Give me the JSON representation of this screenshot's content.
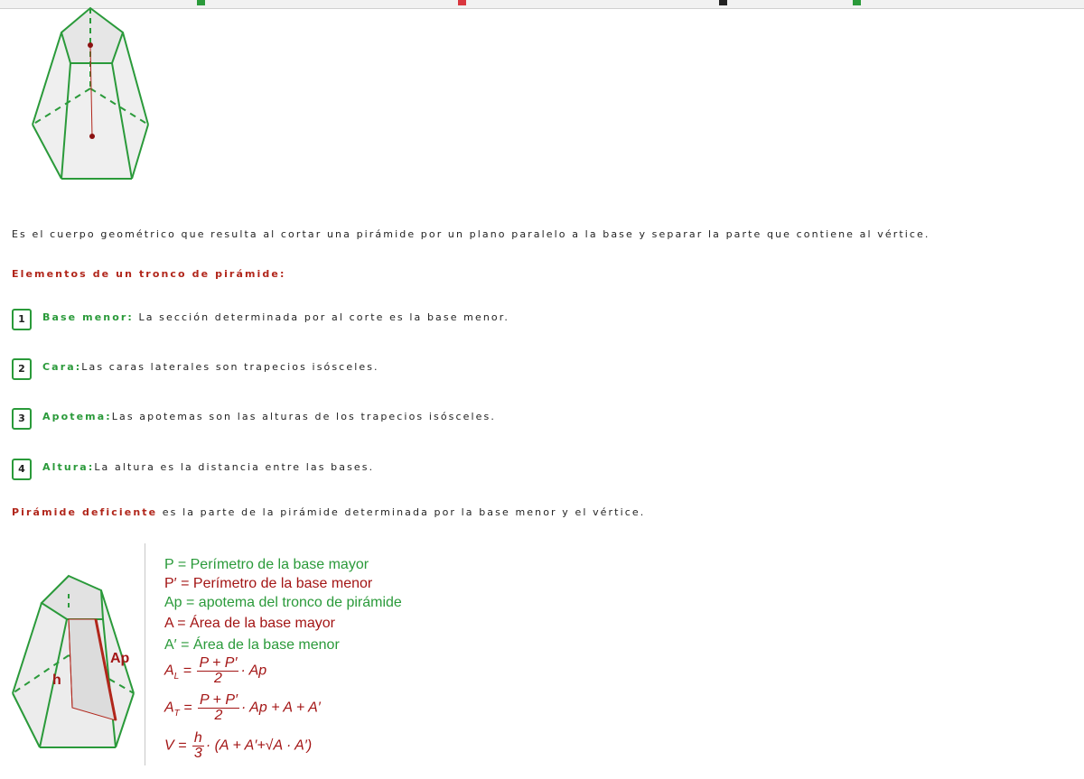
{
  "intro": "Es el cuerpo geométrico que resulta al cortar una pirámide por un plano paralelo a la base y separar la parte que contiene al vértice.",
  "elements_title": "Elementos de un tronco de pirámide:",
  "items": [
    {
      "num": "1",
      "term": "Base menor:",
      "desc": " La sección determinada por al corte es la base menor."
    },
    {
      "num": "2",
      "term": "Cara:",
      "desc": "Las caras laterales son trapecios isósceles."
    },
    {
      "num": "3",
      "term": "Apotema:",
      "desc": "Las apotemas son las alturas de los trapecios isósceles."
    },
    {
      "num": "4",
      "term": "Altura:",
      "desc": "La altura es la distancia entre las bases."
    }
  ],
  "deficiente": {
    "term": "Pirámide deficiente",
    "desc": " es la parte de la pirámide determinada por la base menor y el vértice."
  },
  "figure_labels": {
    "ap": "Ap",
    "h": "h"
  },
  "formulas": {
    "p": "P = Perímetro  de  la base mayor",
    "p_prime": "P′ = Perímetro  de  la base menor",
    "ap": "Ap = apotema del tronco de pirámide",
    "a": "A = Área de la base mayor",
    "a_prime": "A′ = Área de la base menor",
    "al_lhs": "A",
    "al_sub": "L",
    "al_num": "P + P′",
    "al_den": "2",
    "al_rest": "· Ap",
    "at_lhs": "A",
    "at_sub": "T",
    "at_num": "P + P′",
    "at_den": "2",
    "at_rest": "· Ap + A + A′",
    "v_lhs": "V =",
    "v_num": "h",
    "v_den": "3",
    "v_rest": "· (A + A′+√A · A′)"
  },
  "colors": {
    "green": "#2a9a3a",
    "red": "#a31515"
  }
}
